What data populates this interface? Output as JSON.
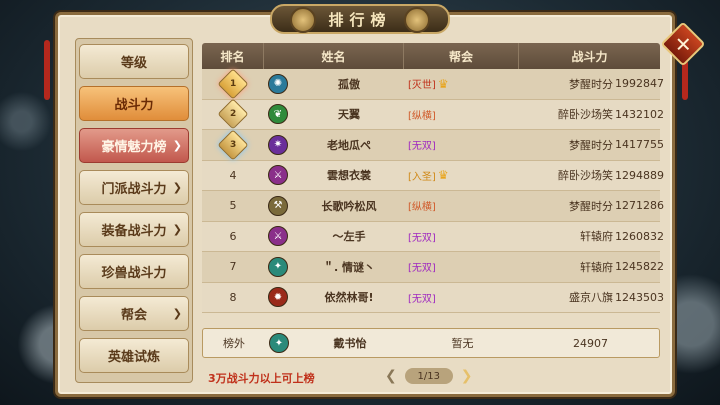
{
  "window": {
    "title": "排行榜"
  },
  "sidebar": {
    "items": [
      {
        "label": "等级",
        "state": "normal",
        "chevron": false
      },
      {
        "label": "战斗力",
        "state": "active",
        "chevron": false
      },
      {
        "label": "豪情魅力榜",
        "state": "expanded",
        "chevron": true
      },
      {
        "label": "门派战斗力",
        "state": "normal",
        "chevron": true
      },
      {
        "label": "装备战斗力",
        "state": "normal",
        "chevron": true
      },
      {
        "label": "珍兽战斗力",
        "state": "normal",
        "chevron": false
      },
      {
        "label": "帮会",
        "state": "normal",
        "chevron": true
      },
      {
        "label": "英雄试炼",
        "state": "normal",
        "chevron": false
      }
    ]
  },
  "table": {
    "headers": [
      "排名",
      "姓名",
      "帮会",
      "战斗力"
    ],
    "rows": [
      {
        "rank": "1",
        "medal": "gold",
        "avatar_color": "#2b7a9a",
        "avatar_icon": "swirl-icon",
        "name": "孤傲",
        "tag": "[灭世]",
        "tag_color": "#c0311b",
        "crown": true,
        "guild": "梦醒时分",
        "power": "1992847"
      },
      {
        "rank": "2",
        "medal": "silver",
        "avatar_color": "#2f8a3a",
        "avatar_icon": "leaf-icon",
        "name": "天翼",
        "tag": "[纵横]",
        "tag_color": "#d05a2a",
        "crown": false,
        "guild": "醉卧沙场笑",
        "power": "1432102"
      },
      {
        "rank": "3",
        "medal": "bronze",
        "avatar_color": "#6a2f9a",
        "avatar_icon": "star-icon",
        "name": "老地瓜ペ",
        "tag": "[无双]",
        "tag_color": "#a02ac0",
        "crown": false,
        "guild": "梦醒时分",
        "power": "1417755"
      },
      {
        "rank": "4",
        "medal": "",
        "avatar_color": "#8a2f8a",
        "avatar_icon": "claw-icon",
        "name": "雲想衣裳",
        "tag": "[入圣]",
        "tag_color": "#d08a1a",
        "crown": true,
        "guild": "醉卧沙场笑",
        "power": "1294889"
      },
      {
        "rank": "5",
        "medal": "",
        "avatar_color": "#7a6a3a",
        "avatar_icon": "sword-icon",
        "name": "长歌吟松风",
        "tag": "[纵横]",
        "tag_color": "#d05a2a",
        "crown": false,
        "guild": "梦醒时分",
        "power": "1271286"
      },
      {
        "rank": "6",
        "medal": "",
        "avatar_color": "#8a2f8a",
        "avatar_icon": "claw-icon",
        "name": "～左手",
        "tag": "[无双]",
        "tag_color": "#a02ac0",
        "crown": false,
        "guild": "轩辕府",
        "power": "1260832"
      },
      {
        "rank": "7",
        "medal": "",
        "avatar_color": "#2a8a7a",
        "avatar_icon": "fan-icon",
        "name": "＂. 情谜丶",
        "tag": "[无双]",
        "tag_color": "#a02ac0",
        "crown": false,
        "guild": "轩辕府",
        "power": "1245822"
      },
      {
        "rank": "8",
        "medal": "",
        "avatar_color": "#9a2a1a",
        "avatar_icon": "flame-icon",
        "name": "依然林哥!",
        "tag": "[无双]",
        "tag_color": "#a02ac0",
        "crown": false,
        "guild": "盛京八旗",
        "power": "1243503"
      }
    ],
    "self_row": {
      "rank": "榜外",
      "avatar_color": "#2a8a7a",
      "avatar_icon": "fan-icon",
      "name": "戴书怡",
      "guild": "暂无",
      "power": "24907"
    }
  },
  "hint": "3万战斗力以上可上榜",
  "pager": {
    "page": "1/13"
  }
}
